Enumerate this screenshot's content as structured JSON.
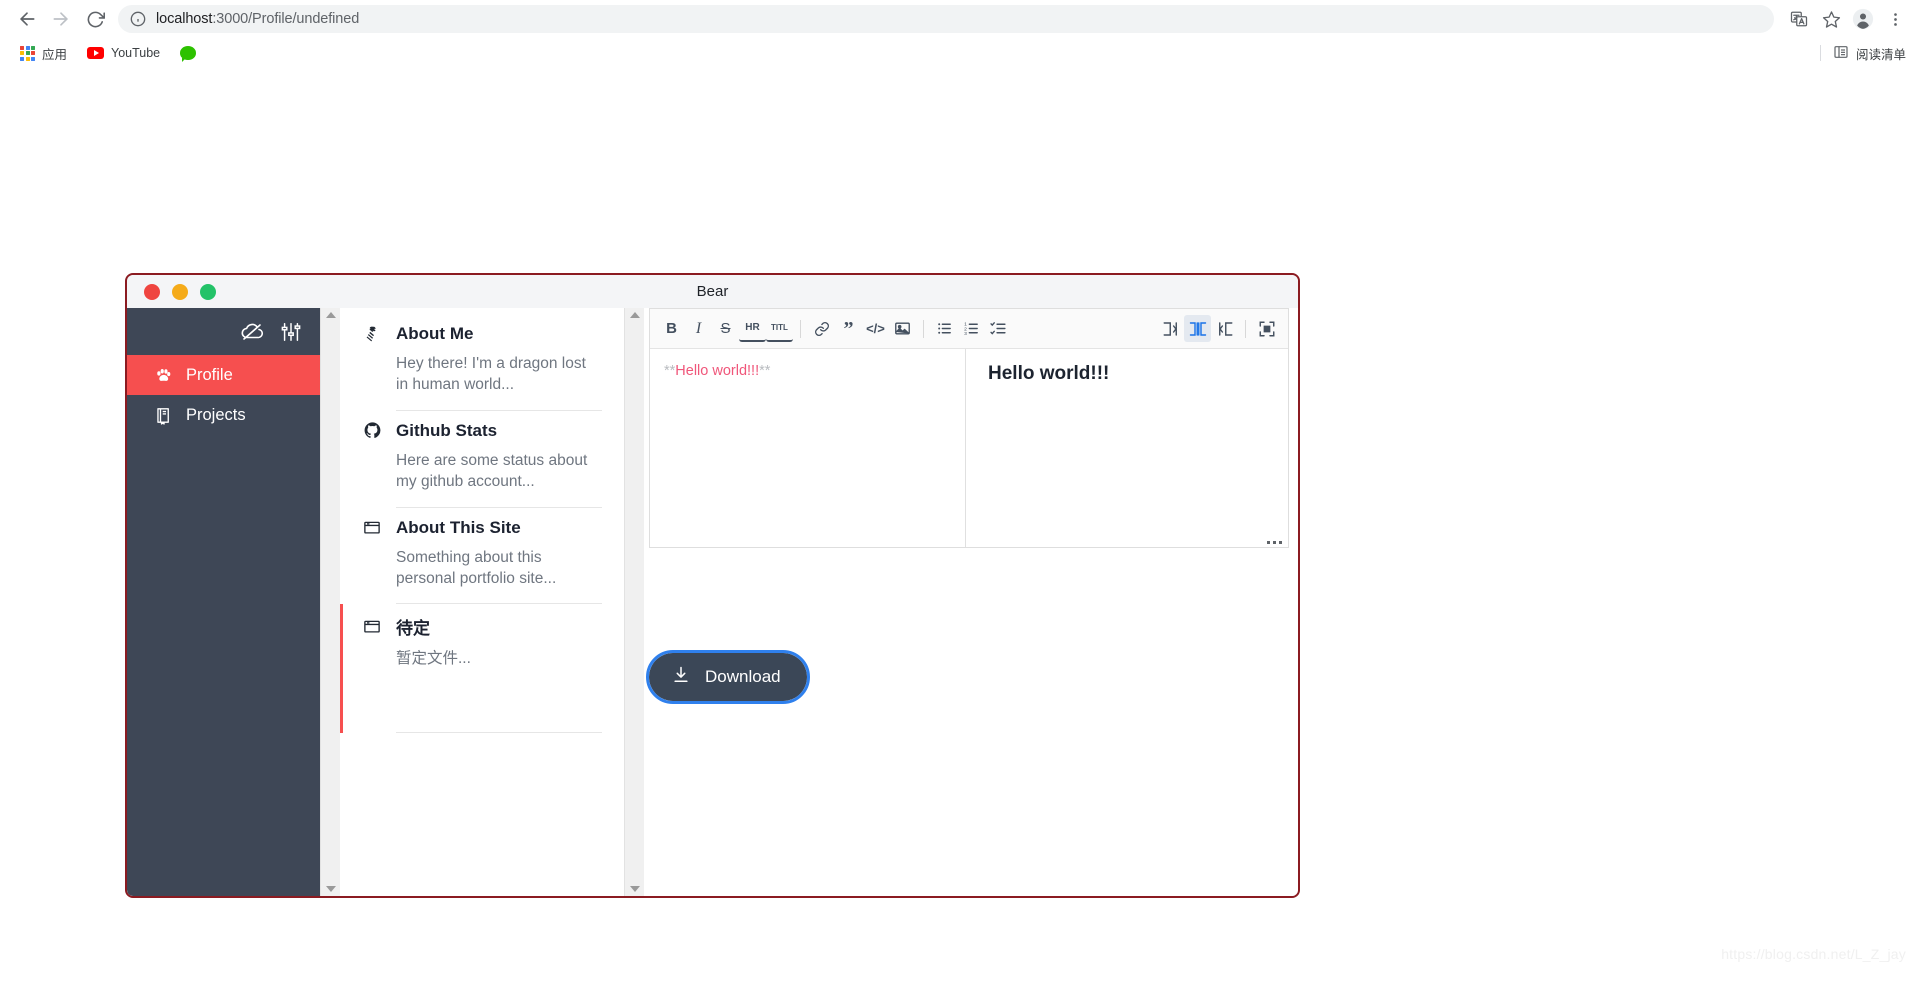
{
  "browser": {
    "back_label": "Back",
    "forward_label": "Forward",
    "reload_label": "Reload",
    "url_host": "localhost",
    "url_path": ":3000/Profile/undefined",
    "site_info_icon": "info-circle-icon",
    "translate_icon": "translate-icon",
    "bookmark_icon": "star-icon",
    "profile_icon": "account-avatar-icon",
    "menu_icon": "three-dot-menu-icon",
    "bookmarks": [
      {
        "label": "应用",
        "icon": "apps-grid-icon"
      },
      {
        "label": "YouTube",
        "icon": "youtube-icon"
      },
      {
        "label": "",
        "icon": "wechat-icon"
      }
    ],
    "reading_list": {
      "label": "阅读清单",
      "icon": "reading-list-icon"
    }
  },
  "app": {
    "title": "Bear",
    "window_controls": [
      "close",
      "minimize",
      "maximize"
    ],
    "sidebar": {
      "top_icons": [
        {
          "name": "cloud-off-icon"
        },
        {
          "name": "sliders-settings-icon"
        }
      ],
      "items": [
        {
          "label": "Profile",
          "icon": "paw-icon",
          "active": true
        },
        {
          "label": "Projects",
          "icon": "book-icon",
          "active": false
        }
      ]
    },
    "notes": [
      {
        "title": "About Me",
        "snippet": "Hey there! I'm a dragon lost in human world...",
        "icon": "dragon-icon",
        "selected": false
      },
      {
        "title": "Github Stats",
        "snippet": "Here are some status about my github account...",
        "icon": "github-icon",
        "selected": false
      },
      {
        "title": "About This Site",
        "snippet": "Something about this personal portfolio site...",
        "icon": "window-icon",
        "selected": false
      },
      {
        "title": "待定",
        "snippet": "暂定文件...",
        "icon": "window-icon",
        "selected": true
      }
    ],
    "editor": {
      "toolbar": [
        {
          "name": "bold-button",
          "label": "B"
        },
        {
          "name": "italic-button",
          "label": "I"
        },
        {
          "name": "strikethrough-button",
          "label": "S"
        },
        {
          "name": "horizontal-rule-button",
          "label": "HR"
        },
        {
          "name": "title-button",
          "label": "TITL"
        },
        {
          "name": "link-button",
          "label": "link-icon"
        },
        {
          "name": "quote-button",
          "label": "quote-icon"
        },
        {
          "name": "code-button",
          "label": "code-icon"
        },
        {
          "name": "image-button",
          "label": "image-icon"
        },
        {
          "name": "unordered-list-button",
          "label": "bullet-list-icon"
        },
        {
          "name": "ordered-list-button",
          "label": "numbered-list-icon"
        },
        {
          "name": "task-list-button",
          "label": "task-list-icon"
        },
        {
          "name": "view-write-only-button",
          "label": "write-only-icon"
        },
        {
          "name": "view-split-button",
          "label": "split-view-icon"
        },
        {
          "name": "view-preview-only-button",
          "label": "preview-only-icon"
        },
        {
          "name": "fullscreen-button",
          "label": "fullscreen-icon"
        }
      ],
      "active_view_mode": "split",
      "source_prefix": "**",
      "source_text": "Hello world!!!",
      "source_suffix": "**",
      "preview_text": "Hello world!!!"
    },
    "download_button": {
      "label": "Download",
      "icon": "download-icon"
    },
    "colors": {
      "accent_red": "#f64f4f",
      "sidebar_bg": "#3e4756",
      "window_border": "#8b1b21",
      "button_bg": "#3b4757",
      "focus_ring": "#2f80ed",
      "markdown_text": "#f0567a"
    }
  },
  "watermark": {
    "text": "https://blog.csdn.net/L_Z_jay"
  }
}
